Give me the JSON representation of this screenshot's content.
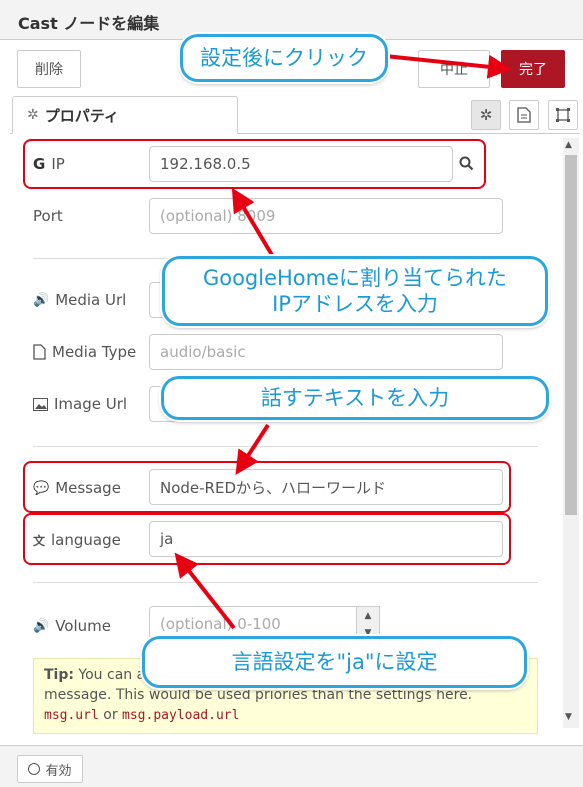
{
  "header": {
    "title": "Cast ノードを編集"
  },
  "toolbar": {
    "delete_label": "削除",
    "cancel_label": "中止",
    "done_label": "完了"
  },
  "tabs": {
    "properties_label": "プロパティ"
  },
  "form": {
    "ip": {
      "label": "IP",
      "value": "192.168.0.5"
    },
    "port": {
      "label": "Port",
      "placeholder": "(optional) 8009"
    },
    "media_url": {
      "label": "Media Url"
    },
    "media_type": {
      "label": "Media Type",
      "placeholder": "audio/basic"
    },
    "image_url": {
      "label": "Image Url"
    },
    "message": {
      "label": "Message",
      "value": "Node-REDから、ハローワールド"
    },
    "language": {
      "label": "language",
      "value": "ja"
    },
    "volume": {
      "label": "Volume",
      "placeholder": "(optional) 0-100"
    }
  },
  "tip": {
    "bold": "Tip:",
    "text1": " You can a",
    "text2": "message. This would be used priories than the settings here.",
    "code1": "msg.url",
    "or": " or ",
    "code2": "msg.payload.url"
  },
  "callouts": {
    "click": "設定後にクリック",
    "ip_line1": "GoogleHomeに割り当てられた",
    "ip_line2": "IPアドレスを入力",
    "text": "話すテキストを入力",
    "lang": "言語設定を\"ja\"に設定"
  },
  "footer": {
    "enabled_label": "有効"
  },
  "colors": {
    "accent_red": "#ad1625",
    "annotation_red": "#e60012",
    "callout_blue": "#2ca6df"
  }
}
